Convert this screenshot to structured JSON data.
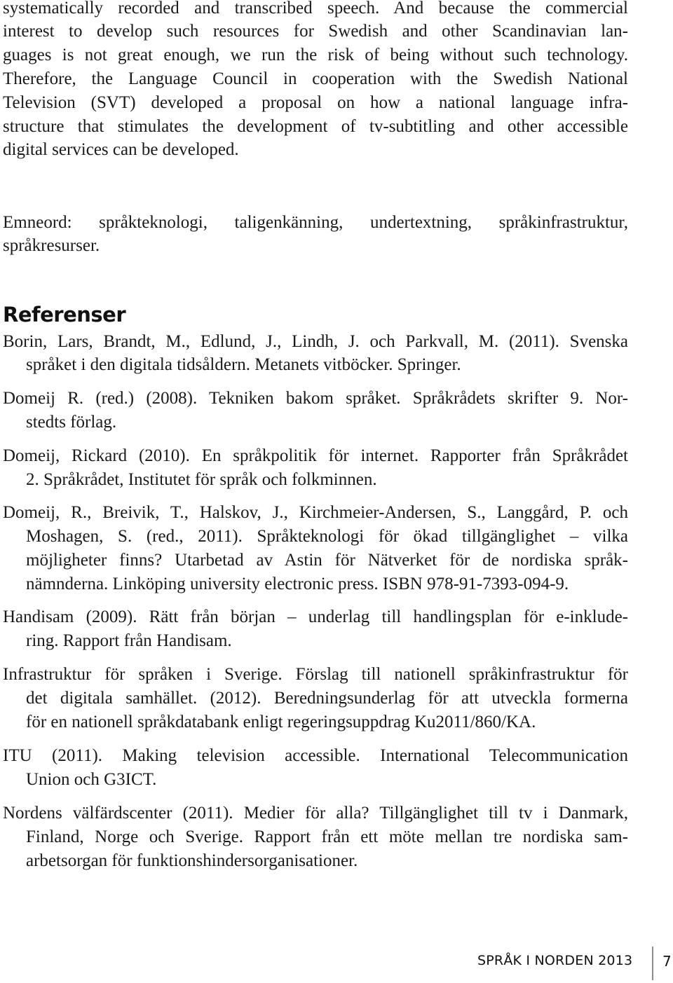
{
  "abstract": {
    "lines": [
      "systematically recorded and transcribed speech. And because the commercial",
      "interest to develop such resources for Swedish and other Scandinavian lan-",
      "guages is not great enough, we run the risk of being without such technology.",
      "Therefore, the Language Council in cooperation with the Swedish National",
      "Television (SVT) developed a proposal on how a national language infra-",
      "structure that stimulates the development of tv-subtitling and other accessible",
      "digital services can be developed."
    ]
  },
  "keywords": {
    "lines": [
      "Emneord: språkteknologi, taligenkänning, undertextning, språkinfrastruktur,",
      "språkresurser."
    ]
  },
  "references": {
    "heading": "Referenser",
    "entries": [
      {
        "lines": [
          "Borin, Lars, Brandt, M., Edlund, J., Lindh, J. och Parkvall, M. (2011). Svenska",
          "språket i den digitala tidsåldern. Metanets vitböcker. Springer."
        ]
      },
      {
        "lines": [
          "Domeij R. (red.) (2008). Tekniken bakom språket. Språkrådets skrifter 9. Nor-",
          "stedts förlag."
        ]
      },
      {
        "lines": [
          "Domeij, Rickard (2010). En språkpolitik för internet. Rapporter från Språkrådet",
          "2. Språkrådet, Institutet för språk och folkminnen."
        ]
      },
      {
        "lines": [
          "Domeij, R., Breivik, T., Halskov, J., Kirchmeier-Andersen, S., Langgård, P. och",
          "Moshagen, S. (red., 2011). Språkteknologi för ökad tillgänglighet – vilka",
          "möjligheter finns? Utarbetad av Astin för Nätverket för de nordiska språk-",
          "nämnderna. Linköping university electronic press. ISBN 978-91-7393-094-9."
        ]
      },
      {
        "lines": [
          "Handisam (2009). Rätt från början – underlag till handlingsplan för e-inklude-",
          "ring. Rapport från Handisam."
        ]
      },
      {
        "lines": [
          "Infrastruktur för språken i Sverige. Förslag till nationell språkinfrastruktur för",
          "det digitala samhället. (2012). Beredningsunderlag för att utveckla formerna",
          "för en nationell språkdatabank enligt regeringsuppdrag Ku2011/860/KA."
        ]
      },
      {
        "lines": [
          "ITU (2011). Making television accessible. International Telecommunication",
          "Union och G3ICT."
        ]
      },
      {
        "lines": [
          "Nordens välfärdscenter (2011). Medier för alla? Tillgänglighet till tv i Danmark,",
          "Finland, Norge och Sverige. Rapport från ett möte mellan tre nordiska sam-",
          "arbetsorgan för funktionshindersorganisationer."
        ]
      }
    ]
  },
  "footer": {
    "publication": "SPRÅK I NORDEN 2013",
    "page_number": "7"
  }
}
